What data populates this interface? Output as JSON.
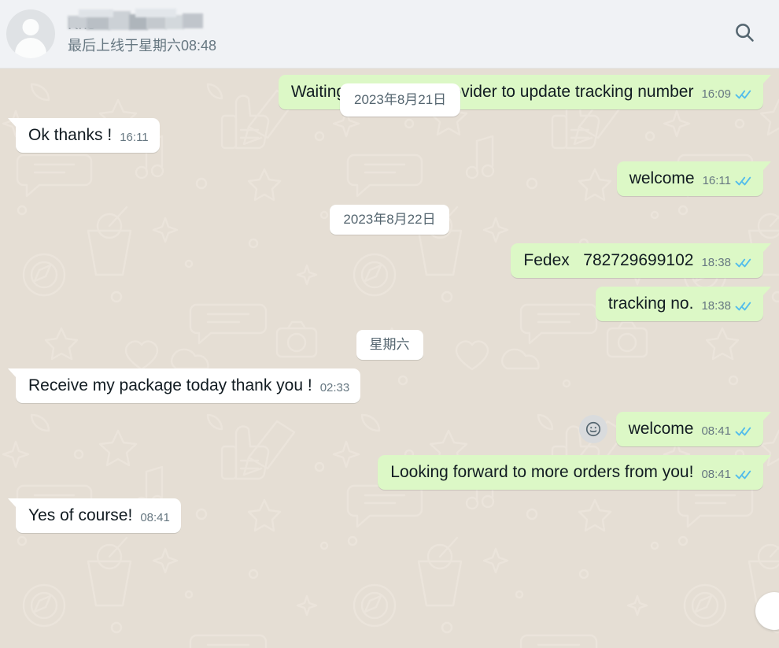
{
  "header": {
    "contact_name": "Kris",
    "contact_name_redacted": true,
    "last_seen": "最后上线于星期六08:48",
    "search_icon": "search-icon",
    "avatar_icon": "default-avatar-icon"
  },
  "floating_date": "2023年8月21日",
  "colors": {
    "header_bg": "#f0f2f5",
    "chat_bg": "#e5ded4",
    "outgoing_bubble": "#dcf8c6",
    "incoming_bubble": "#ffffff",
    "tick_read": "#53bdeb",
    "meta_text": "#667781",
    "primary_text": "#111b21"
  },
  "messages": [
    {
      "kind": "message",
      "direction": "out",
      "text": "Waiting for logistics provider to update tracking number",
      "time": "16:09",
      "status": "read"
    },
    {
      "kind": "message",
      "direction": "in",
      "text": "Ok thanks !",
      "time": "16:11",
      "status": "none"
    },
    {
      "kind": "message",
      "direction": "out",
      "text": "welcome",
      "time": "16:11",
      "status": "read"
    },
    {
      "kind": "divider",
      "text": "2023年8月22日"
    },
    {
      "kind": "message",
      "direction": "out",
      "text": "Fedex   782729699102",
      "time": "18:38",
      "status": "read"
    },
    {
      "kind": "message",
      "direction": "out",
      "text": "tracking no.",
      "time": "18:38",
      "status": "read"
    },
    {
      "kind": "divider",
      "text": "星期六"
    },
    {
      "kind": "message",
      "direction": "in",
      "text": "Receive my package today thank you !",
      "time": "02:33",
      "status": "none"
    },
    {
      "kind": "message",
      "direction": "out",
      "text": "welcome",
      "time": "08:41",
      "status": "read",
      "react_button": true
    },
    {
      "kind": "message",
      "direction": "out",
      "text": "Looking forward to more orders from you!",
      "time": "08:41",
      "status": "read"
    },
    {
      "kind": "message",
      "direction": "in",
      "text": "Yes of course!",
      "time": "08:41",
      "status": "none"
    }
  ],
  "scroll_button": "scroll-to-bottom-button"
}
